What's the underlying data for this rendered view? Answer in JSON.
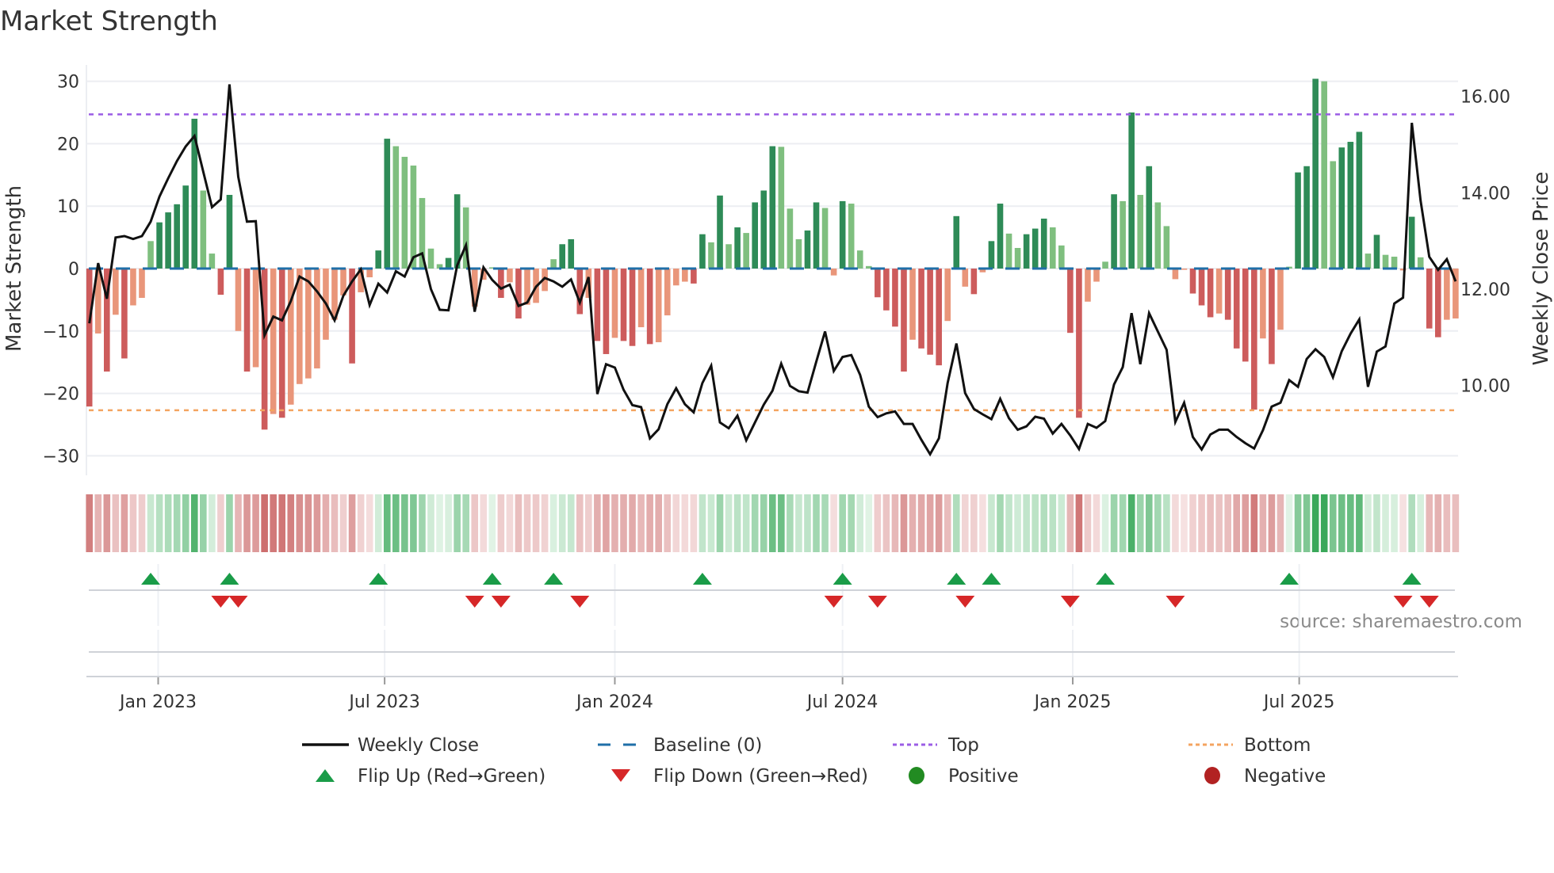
{
  "chart_data": {
    "type": "bar",
    "title": "Market Strength",
    "ylabel": "Market Strength",
    "y2label": "Weekly Close Price",
    "ylim": [
      -33,
      33
    ],
    "y2lim": [
      8.3,
      16.6
    ],
    "y_ticks": [
      30,
      20,
      10,
      0,
      -10,
      -20,
      -30
    ],
    "y_tick_labels": [
      "30",
      "20",
      "10",
      "0",
      "−10",
      "−20",
      "−30"
    ],
    "y2_ticks": [
      16,
      14,
      12,
      10
    ],
    "y2_tick_labels": [
      "16.00",
      "14.00",
      "12.00",
      "10.00"
    ],
    "x_ticks": [
      "2023-01-01",
      "2023-07-01",
      "2024-01-01",
      "2024-07-01",
      "2025-01-01",
      "2025-07-01"
    ],
    "x_tick_labels": [
      "Jan 2023",
      "Jul 2023",
      "Jan 2024",
      "Jul 2024",
      "Jan 2025",
      "Jul 2025"
    ],
    "x_start": "2022-11-07",
    "x_step_days": 7,
    "top_level": 24.7,
    "bottom_level": -22.7,
    "baseline": 0,
    "grid": true,
    "legend_placement": "bottom",
    "strength": [
      -22.1,
      -10.4,
      -16.5,
      -7.4,
      -14.4,
      -5.9,
      -4.7,
      4.4,
      7.4,
      9.0,
      10.3,
      13.3,
      24.0,
      12.5,
      2.4,
      -4.2,
      11.8,
      -10.0,
      -16.5,
      -15.8,
      -25.8,
      -23.3,
      -23.9,
      -21.8,
      -18.5,
      -17.6,
      -16.0,
      -11.4,
      -8.2,
      -4.3,
      -15.2,
      -3.8,
      -1.4,
      2.9,
      20.8,
      19.6,
      17.9,
      16.5,
      11.3,
      3.2,
      0.7,
      1.7,
      11.9,
      9.8,
      -6.1,
      -1.8,
      0.2,
      -4.7,
      -2.2,
      -8.0,
      -5.8,
      -5.5,
      -3.6,
      1.5,
      3.9,
      4.7,
      -7.3,
      -4.7,
      -11.6,
      -13.7,
      -11.1,
      -11.6,
      -12.4,
      -9.4,
      -12.1,
      -11.8,
      -7.5,
      -2.7,
      -2.1,
      -2.4,
      5.5,
      4.2,
      11.7,
      3.9,
      6.6,
      5.7,
      10.6,
      12.5,
      19.6,
      19.5,
      9.6,
      4.7,
      6.1,
      10.6,
      9.7,
      -1.1,
      10.8,
      10.4,
      2.9,
      0.4,
      -4.6,
      -6.7,
      -9.3,
      -16.5,
      -11.4,
      -12.8,
      -13.8,
      -15.5,
      -8.4,
      8.4,
      -2.9,
      -4.1,
      -0.6,
      4.4,
      10.4,
      5.6,
      3.3,
      5.5,
      6.4,
      8.0,
      6.6,
      3.7,
      -10.3,
      -23.9,
      -5.3,
      -2.1,
      1.1,
      11.9,
      10.8,
      25.0,
      11.8,
      16.4,
      10.6,
      6.8,
      -1.7,
      -0.2,
      -4.0,
      -5.9,
      -7.8,
      -7.2,
      -8.2,
      -12.8,
      -14.9,
      -22.6,
      -11.2,
      -15.3,
      -9.8,
      0.3,
      15.4,
      16.4,
      30.4,
      30.0,
      17.2,
      19.4,
      20.3,
      21.9,
      2.4,
      5.4,
      2.2,
      1.9,
      -0.3,
      8.3,
      1.8,
      -9.6,
      -11.0,
      -8.2,
      -8.0
    ],
    "weekly_close": [
      11.29,
      12.54,
      11.8,
      13.07,
      13.1,
      13.04,
      13.1,
      13.4,
      13.92,
      14.3,
      14.66,
      14.96,
      15.18,
      14.44,
      13.7,
      13.86,
      16.25,
      14.33,
      13.4,
      13.41,
      11.04,
      11.43,
      11.35,
      11.75,
      12.26,
      12.16,
      11.95,
      11.7,
      11.35,
      11.86,
      12.16,
      12.41,
      11.67,
      12.11,
      11.93,
      12.37,
      12.26,
      12.66,
      12.74,
      12.0,
      11.57,
      11.56,
      12.49,
      12.91,
      11.53,
      12.45,
      12.19,
      12.01,
      12.09,
      11.65,
      11.72,
      12.05,
      12.23,
      12.16,
      12.05,
      12.2,
      11.72,
      12.25,
      9.82,
      10.44,
      10.37,
      9.91,
      9.59,
      9.55,
      8.9,
      9.09,
      9.61,
      9.94,
      9.61,
      9.44,
      10.05,
      10.41,
      9.23,
      9.11,
      9.37,
      8.86,
      9.23,
      9.6,
      9.89,
      10.45,
      9.99,
      9.88,
      9.85,
      10.49,
      11.12,
      10.3,
      10.59,
      10.63,
      10.22,
      9.56,
      9.34,
      9.42,
      9.46,
      9.2,
      9.2,
      8.87,
      8.57,
      8.9,
      10.05,
      10.87,
      9.84,
      9.51,
      9.4,
      9.3,
      9.72,
      9.32,
      9.08,
      9.15,
      9.35,
      9.31,
      9.0,
      9.2,
      8.96,
      8.68,
      9.2,
      9.12,
      9.26,
      10.02,
      10.38,
      11.5,
      10.44,
      11.5,
      11.12,
      10.74,
      9.24,
      9.64,
      8.93,
      8.67,
      8.98,
      9.08,
      9.08,
      8.93,
      8.8,
      8.69,
      9.07,
      9.56,
      9.64,
      10.11,
      9.97,
      10.55,
      10.75,
      10.59,
      10.17,
      10.71,
      11.07,
      11.37,
      9.97,
      10.7,
      10.81,
      11.7,
      11.82,
      15.45,
      13.84,
      12.67,
      12.4,
      12.62,
      12.16
    ],
    "flip_up_weeks": [
      7,
      16,
      33,
      46,
      53,
      70,
      86,
      99,
      103,
      116,
      137,
      151
    ],
    "flip_down_weeks": [
      15,
      17,
      44,
      47,
      56,
      85,
      90,
      100,
      112,
      124,
      150,
      153
    ],
    "legend": [
      {
        "label": "Weekly Close",
        "symbol": "line"
      },
      {
        "label": "Baseline (0)",
        "symbol": "dash"
      },
      {
        "label": "Top",
        "symbol": "dot-purple"
      },
      {
        "label": "Bottom",
        "symbol": "dot-orange"
      },
      {
        "label": "Flip Up (Red→Green)",
        "symbol": "triangle-up"
      },
      {
        "label": "Flip Down (Green→Red)",
        "symbol": "triangle-down"
      },
      {
        "label": "Positive",
        "symbol": "circle-green"
      },
      {
        "label": "Negative",
        "symbol": "circle-red"
      }
    ],
    "source_note": "source: sharemaestro.com"
  },
  "colors": {
    "pos_dark": "#2e8b57",
    "pos_light": "#7fbf7f",
    "neg_dark": "#cd5c5c",
    "neg_light": "#e9967a",
    "price": "#111111",
    "baseline": "#1f6fa8",
    "top": "#9b5de5",
    "bottom": "#f4a460",
    "flip_up": "#1a9c48",
    "flip_down": "#d62728",
    "positive": "#228b22",
    "negative": "#b22222"
  }
}
